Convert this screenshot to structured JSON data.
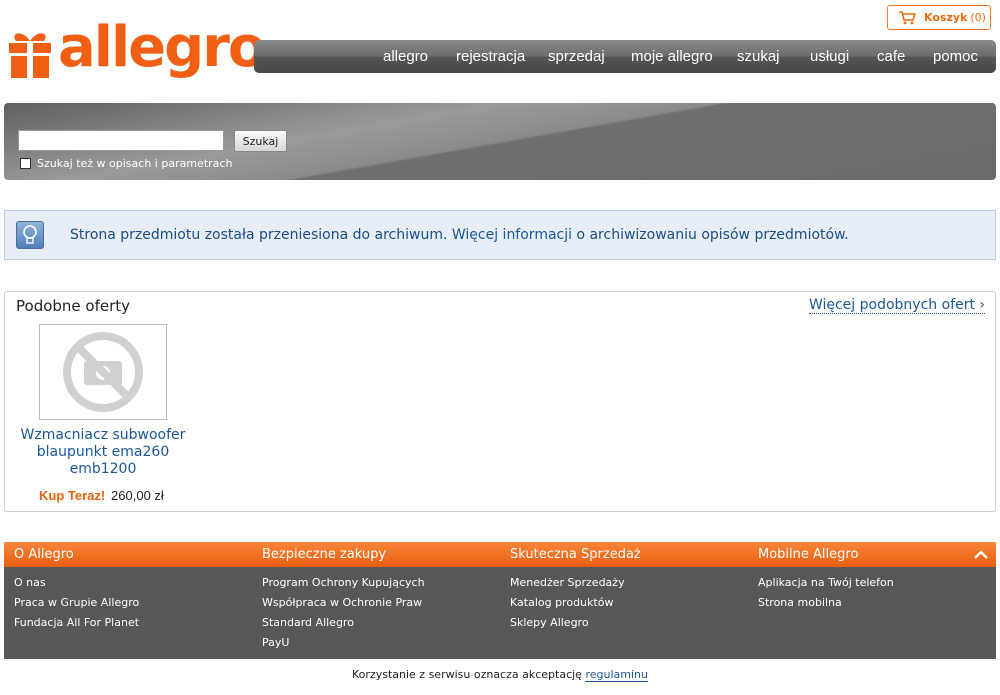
{
  "header": {
    "logo_text": "allegro",
    "cart": {
      "label": "Koszyk",
      "count": "(0)"
    },
    "nav": [
      "allegro",
      "rejestracja",
      "sprzedaj",
      "moje allegro",
      "szukaj",
      "usługi",
      "cafe",
      "pomoc"
    ]
  },
  "search": {
    "input_value": "",
    "button_label": "Szukaj",
    "checkbox_label": "Szukaj też w opisach i parametrach",
    "checkbox_checked": false
  },
  "notice": {
    "text_before": "Strona przedmiotu została przeniesiona do archiwum. ",
    "link_text": "Więcej informacji",
    "text_after": " o archiwizowaniu opisów przedmiotów."
  },
  "similar": {
    "title": "Podobne oferty",
    "more_link": "Więcej podobnych ofert ›",
    "offers": [
      {
        "title": "Wzmacniacz subwoofer blaupunkt ema260 emb1200",
        "buy_label": "Kup Teraz!",
        "price": "260,00 zł"
      }
    ]
  },
  "footer": {
    "columns": [
      {
        "title": "O Allegro",
        "links": [
          "O nas",
          "Praca w Grupie Allegro",
          "Fundacja All For Planet"
        ]
      },
      {
        "title": "Bezpieczne zakupy",
        "links": [
          "Program Ochrony Kupujących",
          "Współpraca w Ochronie Praw",
          "Standard Allegro",
          "PayU"
        ]
      },
      {
        "title": "Skuteczna Sprzedaż",
        "links": [
          "Menedżer Sprzedaży",
          "Katalog produktów",
          "Sklepy Allegro"
        ]
      },
      {
        "title": "Mobilne Allegro",
        "links": [
          "Aplikacja na Twój telefon",
          "Strona mobilna"
        ]
      }
    ],
    "legal_text": "Korzystanie z serwisu oznacza akceptację ",
    "legal_link": "regulaminu"
  },
  "colors": {
    "brand_orange": "#f05f13",
    "link_blue": "#1a5799",
    "nav_gray": "#555555",
    "footer_gray": "#575757"
  }
}
